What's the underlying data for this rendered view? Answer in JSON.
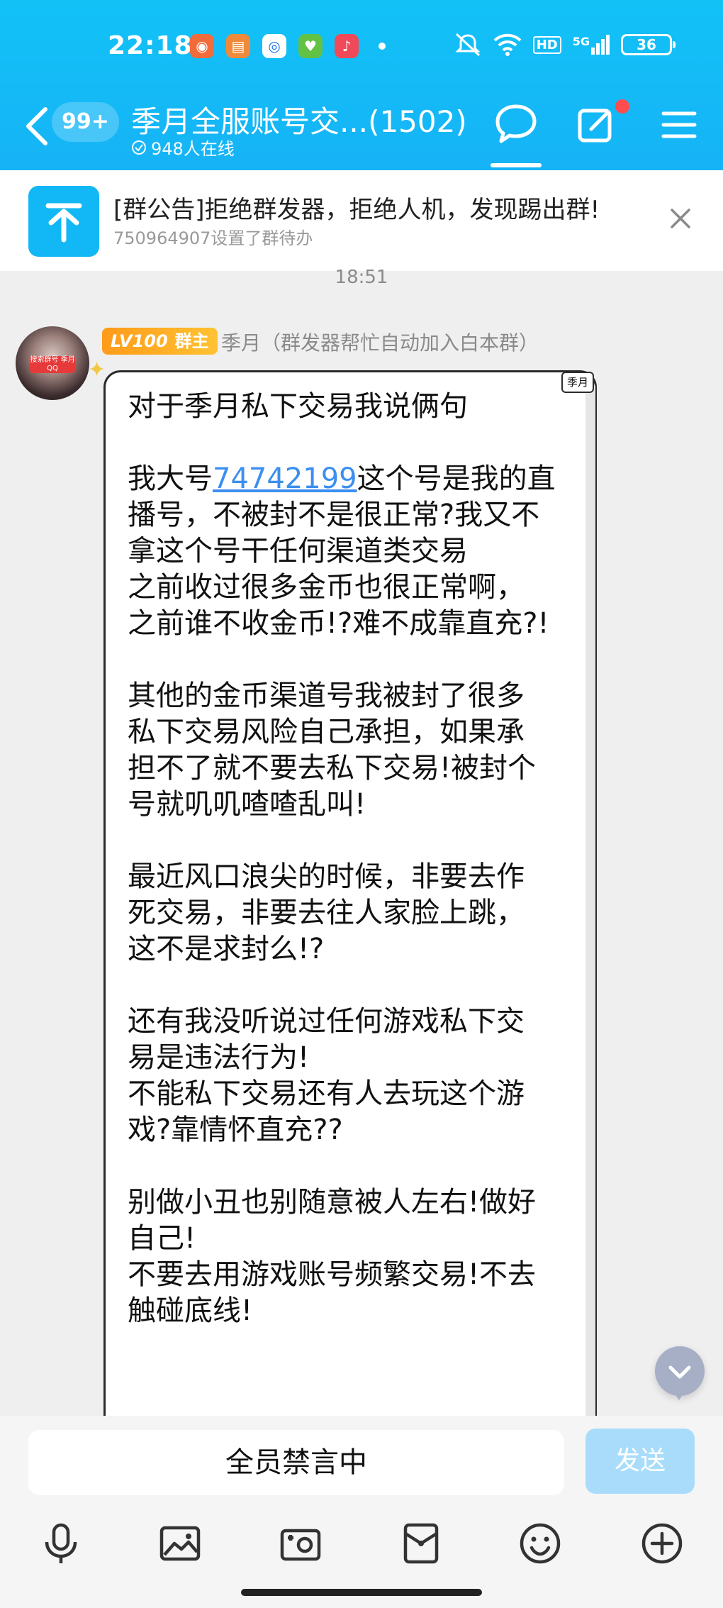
{
  "status_bar": {
    "time": "22:18",
    "app_icons": [
      "camera-app-icon",
      "books-app-icon",
      "browser-app-icon",
      "shopping-app-icon",
      "music-app-icon"
    ],
    "hd_label": "HD",
    "network": "5G",
    "battery": "36"
  },
  "title_bar": {
    "unread_badge": "99+",
    "group_name": "季月全服账号交...",
    "member_count": "(1502)",
    "online": "948人在线"
  },
  "announcement": {
    "title": "[群公告]拒绝群发器，拒绝人机，发现踢出群!",
    "subtitle": "750964907设置了群待办"
  },
  "chat": {
    "timestamp": "18:51",
    "sender": {
      "level": "LV100",
      "role": "群主",
      "name": "季月（群发器帮忙自动加入白本群）",
      "avatar_tag": "搜索群号 季月QQ"
    },
    "bubble_tag": "季月",
    "message": {
      "line_01": "对于季月私下交易我说俩句",
      "line_02_pre": "我大号",
      "line_02_link": "74742199",
      "line_02_post": "这个号是我的直",
      "line_03": "播号，不被封不是很正常?我又不",
      "line_04": "拿这个号干任何渠道类交易",
      "line_05": "之前收过很多金币也很正常啊，",
      "line_06": "之前谁不收金币!?难不成靠直充?!",
      "line_07": "其他的金币渠道号我被封了很多",
      "line_08": "私下交易风险自己承担，如果承",
      "line_09": "担不了就不要去私下交易!被封个",
      "line_10": "号就叽叽喳喳乱叫!",
      "line_11": "最近风口浪尖的时候，非要去作",
      "line_12": "死交易，非要去往人家脸上跳，",
      "line_13": "这不是求封么!?",
      "line_14": "还有我没听说过任何游戏私下交",
      "line_15": "易是违法行为!",
      "line_16": "不能私下交易还有人去玩这个游",
      "line_17": "戏?靠情怀直充??",
      "line_18": "别做小丑也别随意被人左右!做好",
      "line_19": "自己!",
      "line_20": "不要去用游戏账号频繁交易!不去",
      "line_21": "触碰底线!"
    }
  },
  "input": {
    "muted_text": "全员禁言中",
    "send_label": "发送"
  },
  "toolbar_icons": [
    "microphone-icon",
    "image-icon",
    "camera-icon",
    "red-packet-icon",
    "emoji-icon",
    "plus-icon"
  ],
  "colors": {
    "header_blue": "#16b3f6",
    "link_blue": "#3c8ff0",
    "badge_orange": "#ff9b1a",
    "send_disabled": "#a9dcfb"
  }
}
